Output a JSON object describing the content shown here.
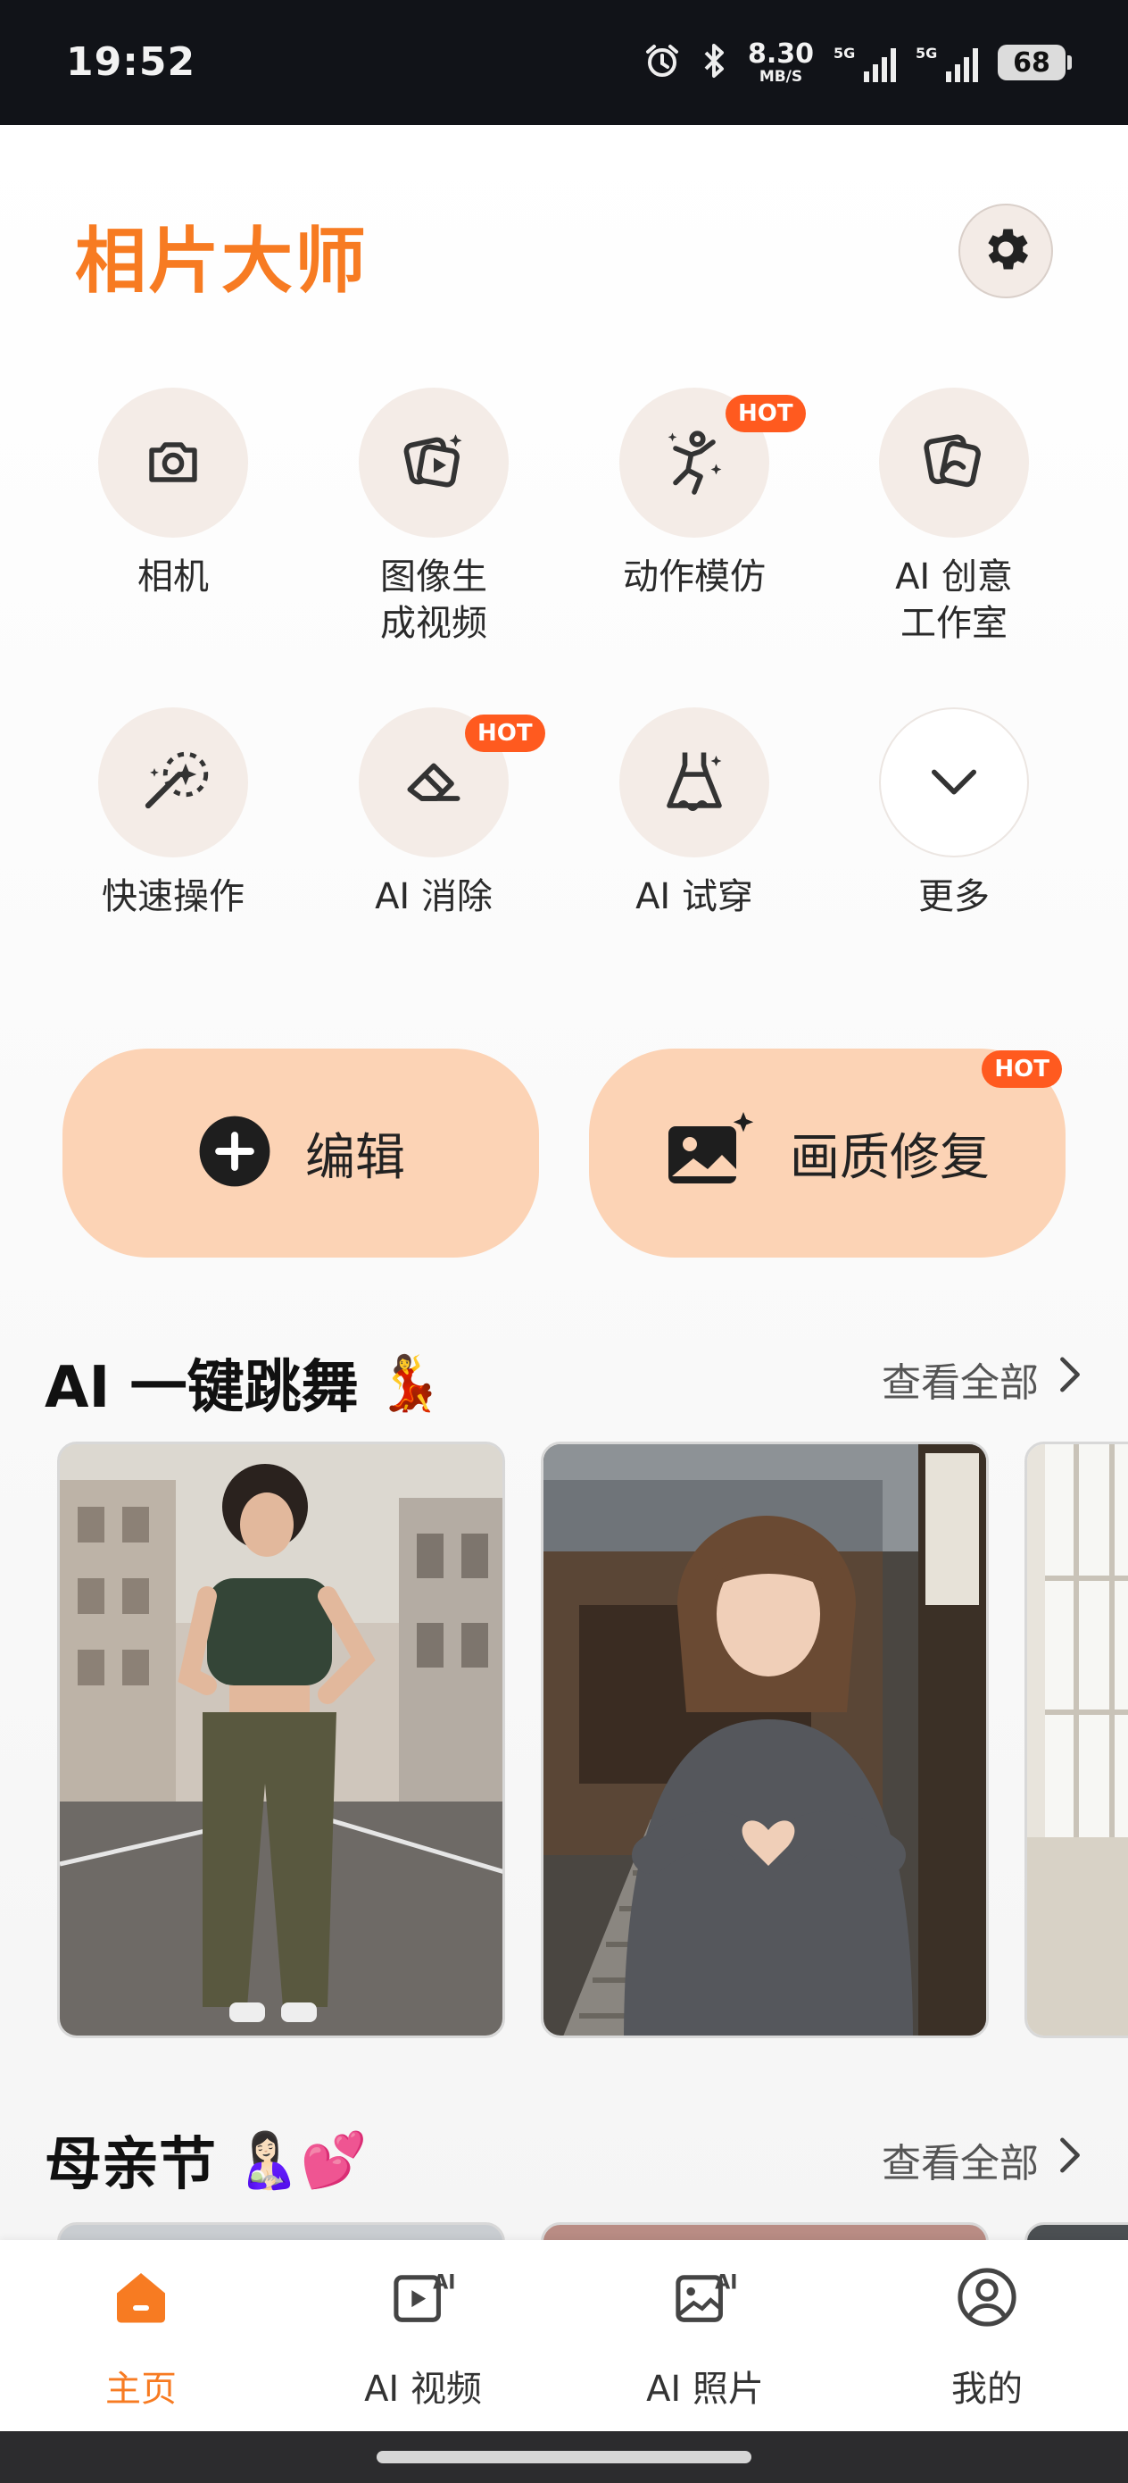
{
  "status_bar": {
    "time": "19:52",
    "speed_value": "8.30",
    "speed_unit": "MB/S",
    "network1": "5G",
    "network2": "5G",
    "battery": "68",
    "icons": [
      "alarm-icon",
      "bluetooth-icon",
      "signal-icon",
      "battery-icon"
    ]
  },
  "header": {
    "title": "相片大师",
    "settings_icon": "gear-icon"
  },
  "tools": [
    {
      "label": "相机",
      "icon": "camera-icon",
      "hot": ""
    },
    {
      "label": "图像生\n成视频",
      "icon": "image-to-video-icon",
      "hot": ""
    },
    {
      "label": "动作模仿",
      "icon": "dance-pose-icon",
      "hot": "HOT"
    },
    {
      "label": "AI 创意\n工作室",
      "icon": "creative-studio-icon",
      "hot": ""
    },
    {
      "label": "快速操作",
      "icon": "magic-wand-icon",
      "hot": ""
    },
    {
      "label": "AI 消除",
      "icon": "eraser-icon",
      "hot": "HOT"
    },
    {
      "label": "AI 试穿",
      "icon": "dress-icon",
      "hot": ""
    },
    {
      "label": "更多",
      "icon": "chevron-down-icon",
      "hot": ""
    }
  ],
  "actions": {
    "edit": {
      "label": "编辑",
      "icon": "plus-circle-icon"
    },
    "restore": {
      "label": "画质修复",
      "icon": "image-sparkle-icon",
      "hot": "HOT"
    }
  },
  "sections": [
    {
      "title": "AI 一键跳舞",
      "emoji": "💃",
      "see_all": "查看全部"
    },
    {
      "title": "母亲节",
      "emoji": "🤱🏻💕",
      "see_all": "查看全部"
    }
  ],
  "bottom_nav": [
    {
      "label": "主页",
      "icon": "home-icon",
      "active": true
    },
    {
      "label": "AI 视频",
      "icon": "ai-video-icon",
      "active": false
    },
    {
      "label": "AI 照片",
      "icon": "ai-photo-icon",
      "active": false
    },
    {
      "label": "我的",
      "icon": "profile-icon",
      "active": false
    }
  ],
  "colors": {
    "accent": "#f77b22",
    "hot_badge": "#ff5a1f",
    "action_button": "#fcd3b5",
    "tool_circle": "#f4ece7"
  }
}
